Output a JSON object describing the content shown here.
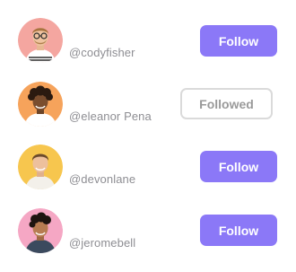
{
  "users": [
    {
      "handle": "@codyfisher",
      "button_label": "Follow",
      "state": "follow",
      "avatar_bg": "#f4a6a0",
      "avatar_icon": "man-glasses-avatar-icon"
    },
    {
      "handle": "@eleanor Pena",
      "button_label": "Followed",
      "state": "followed",
      "avatar_bg": "#f6a35b",
      "avatar_icon": "man-curly-hair-avatar-icon"
    },
    {
      "handle": "@devonlane",
      "button_label": "Follow",
      "state": "follow",
      "avatar_bg": "#f7c64e",
      "avatar_icon": "man-smiling-avatar-icon"
    },
    {
      "handle": "@jeromebell",
      "button_label": "Follow",
      "state": "follow",
      "avatar_bg": "#f5a7c4",
      "avatar_icon": "man-dark-hair-avatar-icon"
    }
  ],
  "colors": {
    "accent": "#8b78f7",
    "followed_border": "#dadada",
    "followed_text": "#9a9a9a",
    "handle_text": "#8e8e93"
  }
}
